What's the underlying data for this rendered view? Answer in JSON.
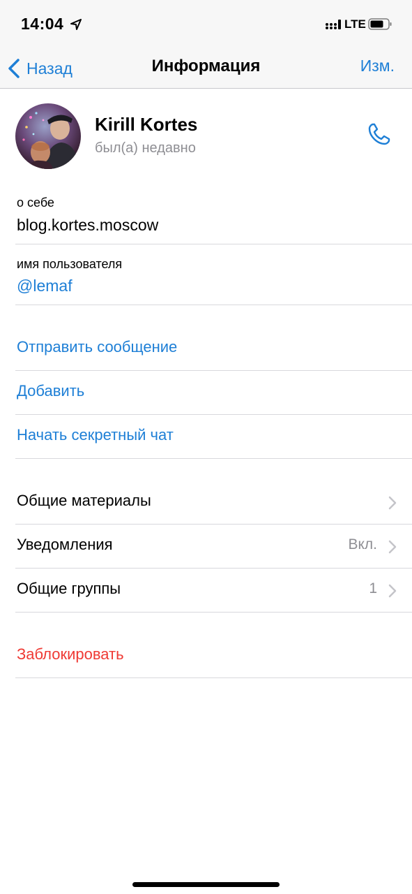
{
  "status_bar": {
    "time": "14:04",
    "network": "LTE",
    "icons": [
      "location-arrow-icon",
      "signal-icon",
      "battery-icon"
    ]
  },
  "nav": {
    "back_label": "Назад",
    "title": "Информация",
    "edit_label": "Изм."
  },
  "profile": {
    "name": "Kirill Kortes",
    "last_seen": "был(а) недавно",
    "call_icon": "phone-icon"
  },
  "about": {
    "label": "о себе",
    "value": "blog.kortes.moscow"
  },
  "username": {
    "label": "имя пользователя",
    "value": "@lemaf"
  },
  "actions": [
    {
      "label": "Отправить сообщение"
    },
    {
      "label": "Добавить"
    },
    {
      "label": "Начать секретный чат"
    }
  ],
  "settings": [
    {
      "label": "Общие материалы",
      "value": ""
    },
    {
      "label": "Уведомления",
      "value": "Вкл."
    },
    {
      "label": "Общие группы",
      "value": "1"
    }
  ],
  "block": {
    "label": "Заблокировать"
  },
  "colors": {
    "accent": "#1e7fd6",
    "destructive": "#ef3a34",
    "secondary_text": "#8e8e93",
    "bar_background": "#f7f7f7"
  }
}
